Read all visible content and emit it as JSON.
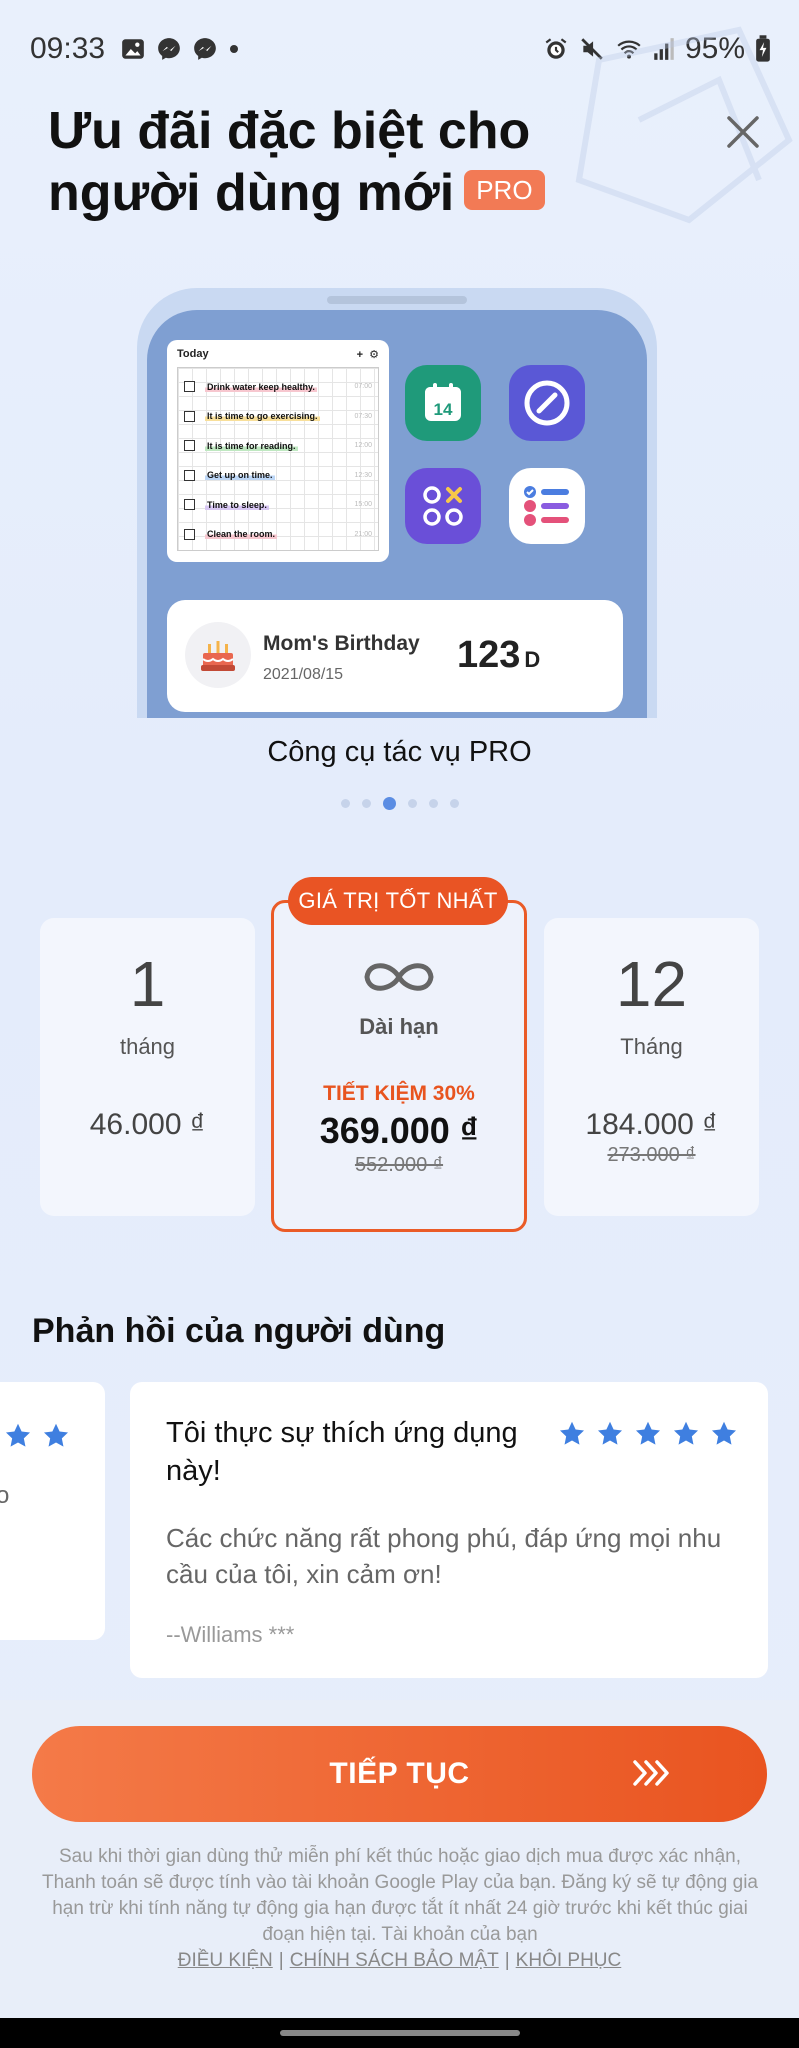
{
  "status_bar": {
    "time": "09:33",
    "battery": "95%",
    "left_icons": [
      "gallery-icon",
      "messenger-icon",
      "messenger-icon",
      "dot-icon"
    ],
    "right_icons": [
      "alarm-icon",
      "mute-icon",
      "wifi-icon",
      "signal-icon",
      "battery-icon"
    ]
  },
  "header": {
    "title": "Ưu đãi đặc biệt cho người dùng mới",
    "pro_badge": "PRO",
    "close_icon": "close-icon"
  },
  "preview": {
    "todo": {
      "title": "Today",
      "items": [
        {
          "text": "Drink water keep healthy.",
          "time": "07:00",
          "highlight": "#f7c7cf"
        },
        {
          "text": "It is time to go exercising.",
          "time": "07:30",
          "highlight": "#f8df9a"
        },
        {
          "text": "It is time for reading.",
          "time": "12:00",
          "highlight": "#bfe8c1"
        },
        {
          "text": "Get up on time.",
          "time": "12:30",
          "highlight": "#bcd6f6"
        },
        {
          "text": "Time to sleep.",
          "time": "15:00",
          "highlight": "#d8c7f3"
        },
        {
          "text": "Clean the room.",
          "time": "21:00",
          "highlight": "#f7c7cf"
        }
      ]
    },
    "calendar_day": "14",
    "event": {
      "title": "Mom's Birthday",
      "date": "2021/08/15",
      "count": "123",
      "unit": "D"
    },
    "caption": "Công cụ tác vụ PRO",
    "page_count": 6,
    "active_page": 3
  },
  "plans": {
    "best_tag": "GIÁ TRỊ TỐT NHẤT",
    "monthly": {
      "big": "1",
      "unit": "tháng",
      "price": "46.000 ₫"
    },
    "lifetime": {
      "label": "Dài hạn",
      "save": "TIẾT KIỆM 30%",
      "price": "369.000 ₫",
      "old_price": "552.000 ₫"
    },
    "yearly": {
      "big": "12",
      "unit": "Tháng",
      "price": "184.000 ₫",
      "old_price": "273.000 ₫"
    }
  },
  "reviews": {
    "section_title": "Phản hồi của người dùng",
    "card": {
      "title": "Tôi thực sự thích ứng dụng này!",
      "body": "Các chức năng rất phong phú, đáp ứng mọi nhu cầu của tôi, xin cảm ơn!",
      "author": "--Williams ***",
      "stars": 5
    },
    "peek_card": {
      "stars": 2,
      "fragment": "o"
    }
  },
  "cta": {
    "label": "TIẾP TỤC"
  },
  "legal": {
    "text": "Sau khi thời gian dùng thử miễn phí kết thúc hoặc giao dịch mua được xác nhận, Thanh toán sẽ được tính vào tài khoản Google Play của bạn. Đăng ký sẽ tự động gia hạn trừ khi tính năng tự động gia hạn được tắt ít nhất 24 giờ trước khi kết thúc giai đoạn hiện tại. Tài khoản của bạn",
    "links": [
      "ĐIỀU KIỆN",
      "CHÍNH SÁCH BẢO MẬT",
      "KHÔI PHỤC"
    ],
    "separator": "|"
  },
  "colors": {
    "accent": "#e95424",
    "star": "#3f7fe0",
    "phone_screen": "#7f9fd2"
  }
}
